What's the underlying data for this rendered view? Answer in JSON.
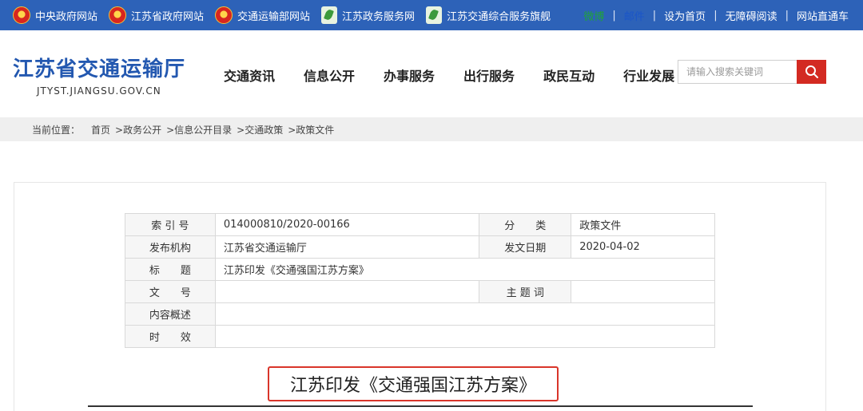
{
  "topbar": {
    "links": [
      {
        "label": "中央政府网站",
        "icon": "emblem"
      },
      {
        "label": "江苏省政府网站",
        "icon": "emblem"
      },
      {
        "label": "交通运输部网站",
        "icon": "emblem"
      },
      {
        "label": "江苏政务服务网",
        "icon": "leaf"
      },
      {
        "label": "江苏交通综合服务旗舰",
        "icon": "leaf"
      }
    ],
    "right": {
      "item1": "微博",
      "item2": "邮件",
      "set_home": "设为首页",
      "accessible": "无障碍阅读",
      "site_express": "网站直通车"
    }
  },
  "header": {
    "title": "江苏省交通运输厅",
    "domain": "JTYST.JIANGSU.GOV.CN",
    "nav": [
      "交通资讯",
      "信息公开",
      "办事服务",
      "出行服务",
      "政民互动",
      "行业发展"
    ],
    "search_placeholder": "请输入搜索关键词"
  },
  "breadcrumb": {
    "label": "当前位置：",
    "items": [
      "首页",
      ">政务公开",
      ">信息公开目录",
      ">交通政策",
      ">政策文件"
    ]
  },
  "meta": {
    "index_label": "索 引 号",
    "index_value": "014000810/2020-00166",
    "category_label": "分　　类",
    "category_value": "政策文件",
    "publisher_label": "发布机构",
    "publisher_value": "江苏省交通运输厅",
    "date_label": "发文日期",
    "date_value": "2020-04-02",
    "title_label": "标　　题",
    "title_value": "江苏印发《交通强国江苏方案》",
    "docno_label": "文　　号",
    "docno_value": "",
    "keyword_label": "主 题 词",
    "keyword_value": "",
    "summary_label": "内容概述",
    "summary_value": "",
    "validity_label": "时　　效",
    "validity_value": ""
  },
  "article": {
    "title": "江苏印发《交通强国江苏方案》"
  },
  "colors": {
    "topbar": "#2d62b8",
    "brand_blue": "#2358b0",
    "search_red": "#d32a22",
    "highlight_red": "#d9352a"
  }
}
